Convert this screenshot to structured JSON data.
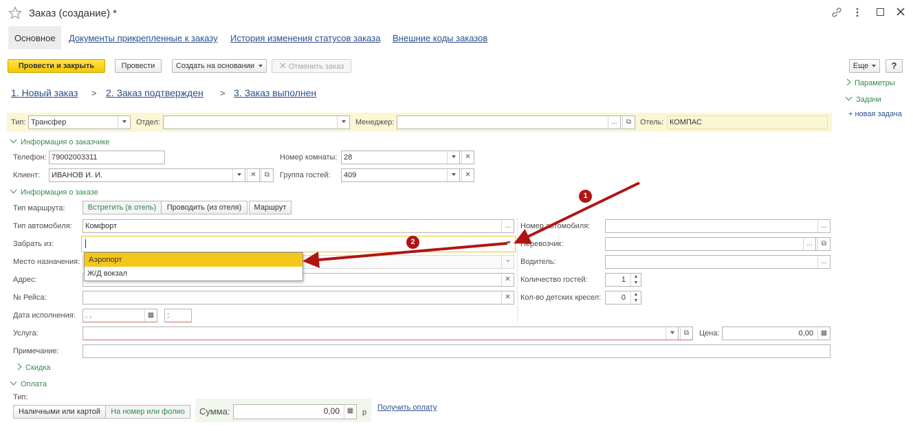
{
  "window": {
    "title": "Заказ (создание) *"
  },
  "tabs": [
    {
      "label": "Основное"
    },
    {
      "label": "Документы прикрепленные к заказу"
    },
    {
      "label": "История изменения статусов заказа"
    },
    {
      "label": "Внешние коды заказов"
    }
  ],
  "toolbar": {
    "post_close": "Провести и закрыть",
    "post": "Провести",
    "create_based": "Создать на основании",
    "cancel_order": "Отменить заказ",
    "more": "Еще",
    "help": "?"
  },
  "steps": [
    "1. Новый заказ",
    "2. Заказ подтвержден",
    "3. Заказ выполнен"
  ],
  "side_panel": {
    "params": "Параметры",
    "tasks": "Задачи",
    "new_task": "+ новая задача"
  },
  "header": {
    "type_label": "Тип:",
    "type_value": "Трансфер",
    "dept_label": "Отдел:",
    "dept_value": "",
    "manager_label": "Менеджер:",
    "manager_value": "",
    "hotel_label": "Отель:",
    "hotel_value": "КОМПАС"
  },
  "customer": {
    "section": "Информация о заказчике",
    "phone_label": "Телефон:",
    "phone_value": "79002003311",
    "room_label": "Номер комнаты:",
    "room_value": "28",
    "client_label": "Клиент:",
    "client_value": "ИВАНОВ И. И.",
    "group_label": "Группа гостей:",
    "group_value": "409"
  },
  "order": {
    "section": "Информация о заказе",
    "route_label": "Тип маршрута:",
    "route_options": [
      "Встретить (в отель)",
      "Проводить (из отеля)",
      "Маршрут"
    ],
    "car_type_label": "Тип автомобиля:",
    "car_type_value": "Комфорт",
    "pickup_label": "Забрать из:",
    "pickup_value": "",
    "dest_label": "Место назначения:",
    "address_label": "Адрес:",
    "flight_label": "№ Рейса:",
    "date_label": "Дата исполнения:",
    "date_value": " .  .",
    "time_value": " :",
    "service_label": "Услуга:",
    "price_label": "Цена:",
    "price_value": "0,00",
    "note_label": "Примечание:",
    "car_number_label": "Номер автомобиля:",
    "carrier_label": "Перевозчик:",
    "driver_label": "Водитель:",
    "guests_label": "Количество гостей:",
    "guests_value": "1",
    "child_seats_label": "Кол-во детских кресел:",
    "child_seats_value": "0"
  },
  "dropdown": {
    "items": [
      "Аэропорт",
      "Ж/Д вокзал"
    ],
    "selected_index": 0
  },
  "discount": {
    "section": "Скидка"
  },
  "payment": {
    "section": "Оплата",
    "type_label": "Тип:",
    "options": [
      "Наличными или картой",
      "На номер или фолио"
    ],
    "sum_label": "Сумма:",
    "sum_value": "0,00",
    "currency": "р",
    "get_payment": "Получить оплату"
  },
  "annotations": {
    "marker1": "1",
    "marker2": "2"
  },
  "colors": {
    "accent_yellow": "#ffd83a",
    "highlight_bg": "#fbf6d4",
    "section_green": "#3a8a4f",
    "link_blue": "#2b4f8a",
    "arrow_red": "#b01414"
  }
}
